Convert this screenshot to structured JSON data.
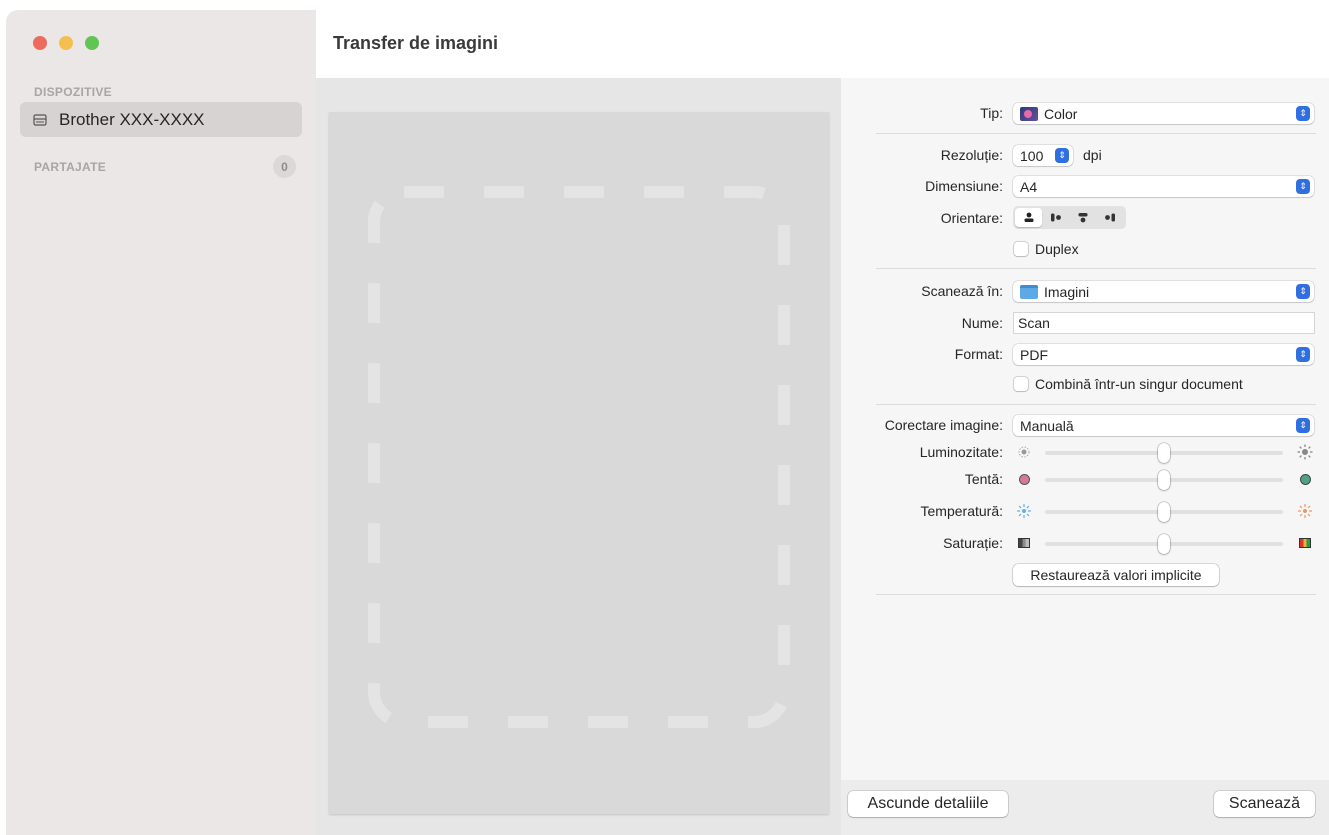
{
  "window": {
    "title": "Transfer de imagini"
  },
  "sidebar": {
    "devices_header": "DISPOZITIVE",
    "device": {
      "label": "Brother XXX-XXXX",
      "icon": "scanner-icon"
    },
    "shared_header": "PARTAJATE",
    "shared_count": "0"
  },
  "settings": {
    "type": {
      "label": "Tip:",
      "value": "Color"
    },
    "resolution": {
      "label": "Rezoluție:",
      "value": "100",
      "unit": "dpi"
    },
    "size": {
      "label": "Dimensiune:",
      "value": "A4"
    },
    "orientation": {
      "label": "Orientare:",
      "selected": "portrait-upright"
    },
    "duplex": {
      "label": "Duplex",
      "checked": false
    },
    "scan_to": {
      "label": "Scanează în:",
      "value": "Imagini"
    },
    "name": {
      "label": "Nume:",
      "value": "Scan"
    },
    "format": {
      "label": "Format:",
      "value": "PDF"
    },
    "combine": {
      "label": "Combină într-un singur document",
      "checked": false
    },
    "image_correction": {
      "label": "Corectare imagine:",
      "value": "Manuală"
    },
    "brightness": {
      "label": "Luminozitate:",
      "value": 0.5
    },
    "tint": {
      "label": "Tentă:",
      "value": 0.5
    },
    "temperature": {
      "label": "Temperatură:",
      "value": 0.5
    },
    "saturation": {
      "label": "Saturație:",
      "value": 0.5
    },
    "restore_button": "Restaurează valori implicite"
  },
  "footer": {
    "hide_details": "Ascunde detaliile",
    "scan": "Scanează"
  },
  "colors": {
    "accent": "#2f6fe0",
    "sidebar_bg": "#ebe7e7",
    "selected_item": "#d7d3d3"
  }
}
